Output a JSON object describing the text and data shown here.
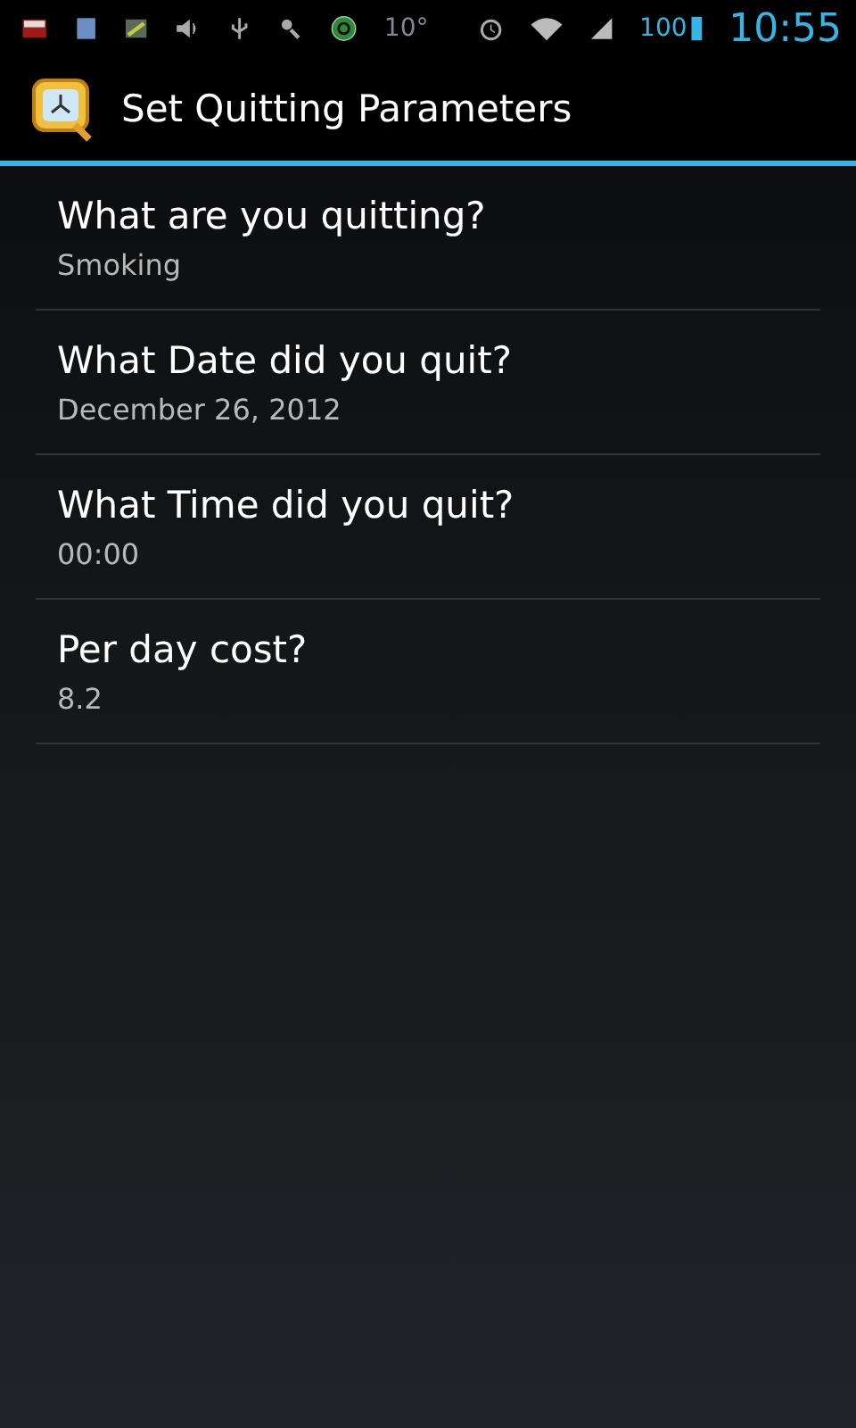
{
  "status_bar": {
    "temperature": "10°",
    "battery": "100",
    "time": "10:55"
  },
  "action_bar": {
    "title": "Set Quitting Parameters"
  },
  "preferences": [
    {
      "title": "What are you quitting?",
      "summary": "Smoking"
    },
    {
      "title": "What Date did you quit?",
      "summary": "December 26, 2012"
    },
    {
      "title": "What Time did you quit?",
      "summary": "00:00"
    },
    {
      "title": "Per day cost?",
      "summary": "8.2"
    }
  ]
}
